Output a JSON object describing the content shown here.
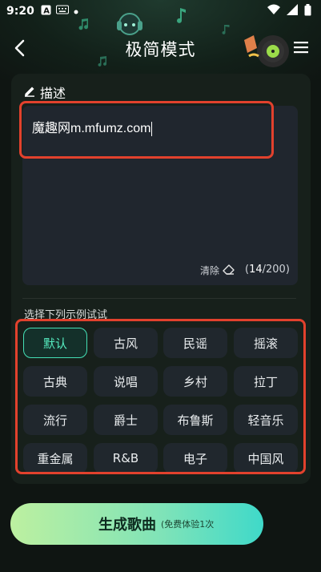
{
  "status": {
    "time": "9:20",
    "icons": [
      "notification-a-icon",
      "keyboard-icon",
      "dot-icon",
      "wifi-icon",
      "signal-icon",
      "battery-icon"
    ]
  },
  "header": {
    "title": "极简模式",
    "back_icon": "back-arrow-icon",
    "menu_icon": "menu-icon"
  },
  "description": {
    "label": "描述",
    "label_icon": "edit-icon",
    "value": "魔趣网m.mfumz.com",
    "clear_label": "清除",
    "clear_icon": "eraser-icon",
    "count_open": "(",
    "count_current": "14",
    "count_sep": "/200)"
  },
  "examples": {
    "label": "选择下列示例试试",
    "items": [
      {
        "label": "默认",
        "active": true
      },
      {
        "label": "古风",
        "active": false
      },
      {
        "label": "民谣",
        "active": false
      },
      {
        "label": "摇滚",
        "active": false
      },
      {
        "label": "古典",
        "active": false
      },
      {
        "label": "说唱",
        "active": false
      },
      {
        "label": "乡村",
        "active": false
      },
      {
        "label": "拉丁",
        "active": false
      },
      {
        "label": "流行",
        "active": false
      },
      {
        "label": "爵士",
        "active": false
      },
      {
        "label": "布鲁斯",
        "active": false
      },
      {
        "label": "轻音乐",
        "active": false
      },
      {
        "label": "重金属",
        "active": false
      },
      {
        "label": "R&B",
        "active": false
      },
      {
        "label": "电子",
        "active": false
      },
      {
        "label": "中国风",
        "active": false
      }
    ]
  },
  "cta": {
    "label": "生成歌曲",
    "sub": "(免费体验1次"
  },
  "colors": {
    "accent": "#44e0b6",
    "highlight": "#e2412d",
    "panel": "#17201b"
  }
}
